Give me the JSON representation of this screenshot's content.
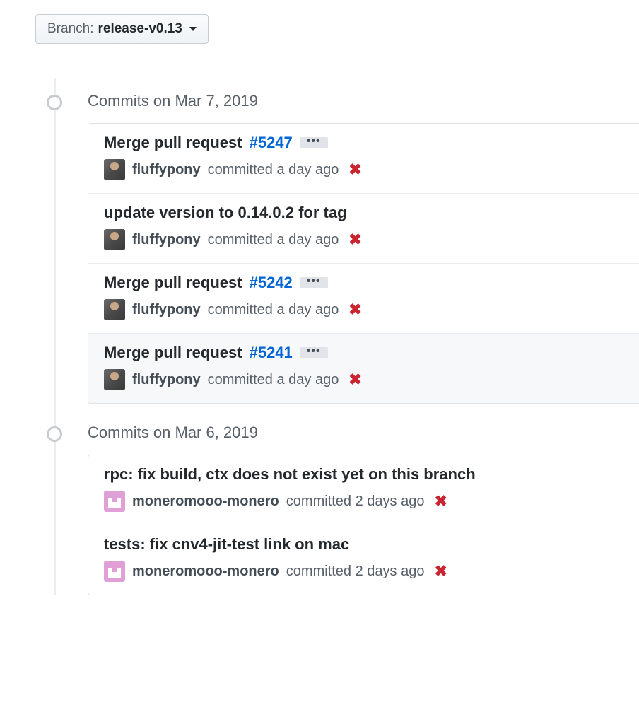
{
  "branch": {
    "prefix": "Branch:",
    "name": "release-v0.13"
  },
  "groups": [
    {
      "header": "Commits on Mar 7, 2019",
      "commits": [
        {
          "title_prefix": "Merge pull request",
          "pr": "#5247",
          "has_ellipsis": true,
          "author": "fluffypony",
          "time_text": "committed a day ago",
          "status": "fail",
          "avatar": "a1",
          "highlight": false
        },
        {
          "title_full": "update version to 0.14.0.2 for tag",
          "has_ellipsis": false,
          "author": "fluffypony",
          "time_text": "committed a day ago",
          "status": "fail",
          "avatar": "a1",
          "highlight": false
        },
        {
          "title_prefix": "Merge pull request",
          "pr": "#5242",
          "has_ellipsis": true,
          "author": "fluffypony",
          "time_text": "committed a day ago",
          "status": "fail",
          "avatar": "a1",
          "highlight": false
        },
        {
          "title_prefix": "Merge pull request",
          "pr": "#5241",
          "has_ellipsis": true,
          "author": "fluffypony",
          "time_text": "committed a day ago",
          "status": "fail",
          "avatar": "a1",
          "highlight": true
        }
      ]
    },
    {
      "header": "Commits on Mar 6, 2019",
      "commits": [
        {
          "title_full": "rpc: fix build, ctx does not exist yet on this branch",
          "has_ellipsis": false,
          "author": "moneromooo-monero",
          "time_text": "committed 2 days ago",
          "status": "fail",
          "avatar": "a2",
          "highlight": false
        },
        {
          "title_full": "tests: fix cnv4-jit-test link on mac",
          "has_ellipsis": false,
          "author": "moneromooo-monero",
          "time_text": "committed 2 days ago",
          "status": "fail",
          "avatar": "a2",
          "highlight": false
        }
      ]
    }
  ]
}
